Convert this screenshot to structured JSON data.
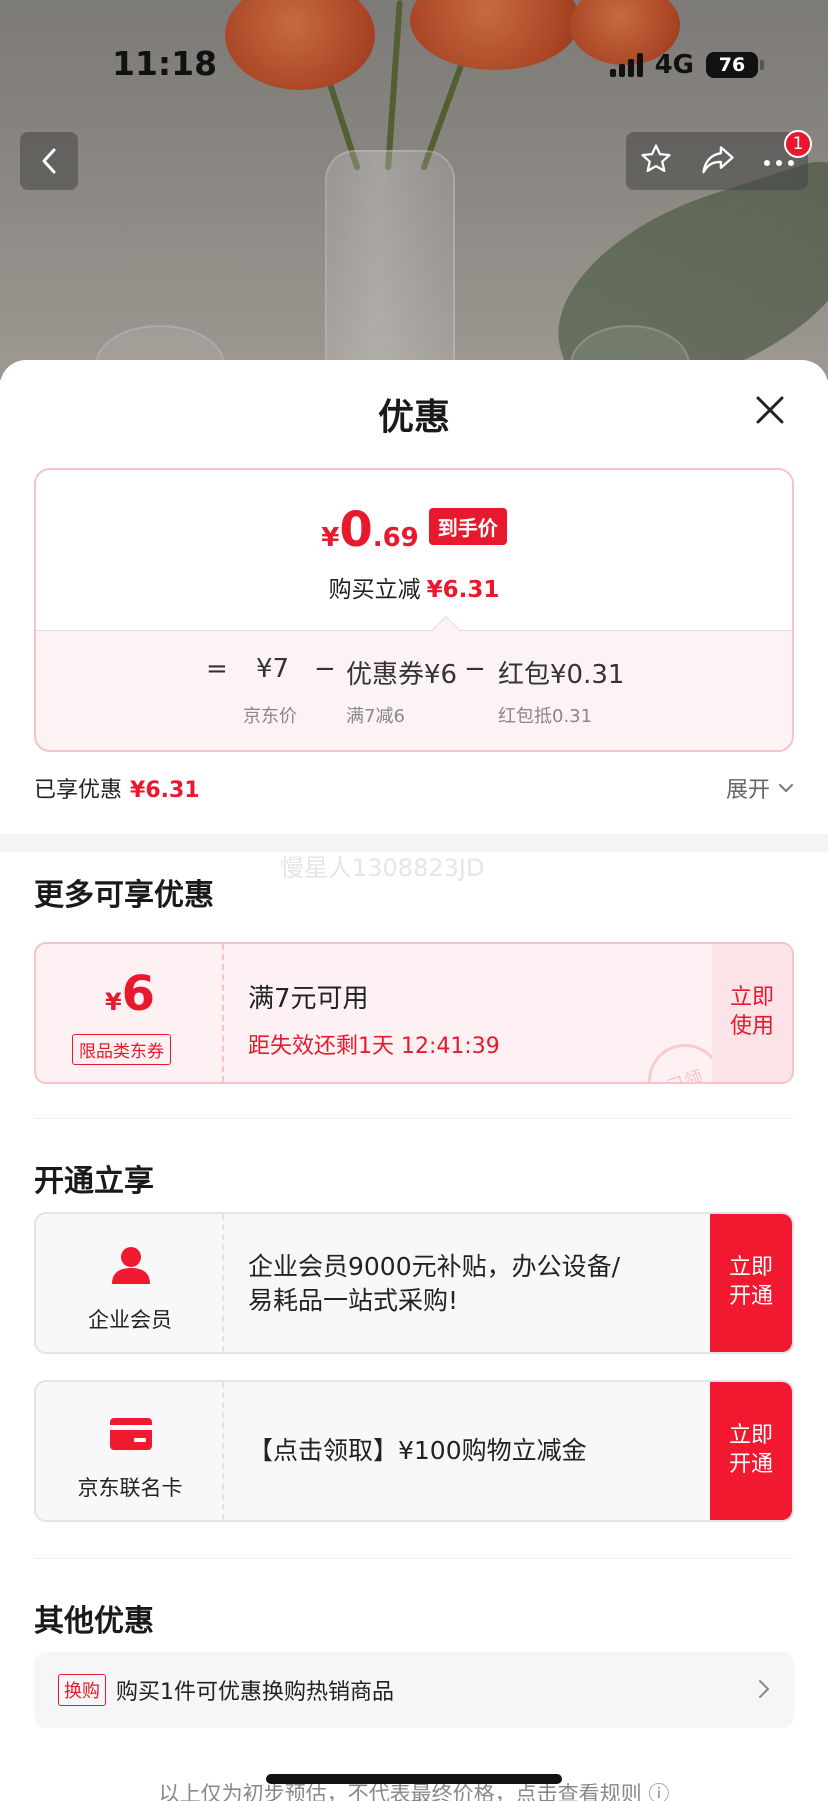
{
  "status_bar": {
    "time": "11:18",
    "network": "4G",
    "battery": "76"
  },
  "nav": {
    "badge_count": "1"
  },
  "sheet": {
    "title": "优惠",
    "price": {
      "currency": "¥",
      "integer": "0",
      "decimal": ".69",
      "tag": "到手价",
      "reduce_label": "购买立减",
      "reduce_value": "¥6.31"
    },
    "breakdown": {
      "equals": "=",
      "jd_price": "¥7",
      "jd_price_label": "京东价",
      "minus1": "−",
      "coupon": "优惠券¥6",
      "coupon_label": "满7减6",
      "minus2": "−",
      "redpack": "红包¥0.31",
      "redpack_label": "红包抵0.31"
    },
    "enjoyed_label": "已享优惠",
    "enjoyed_value": "¥6.31",
    "expand_label": "展开",
    "watermark": "慢星人1308823JD"
  },
  "more": {
    "title": "更多可享优惠",
    "coupon": {
      "currency": "¥",
      "amount": "6",
      "type": "限品类东券",
      "condition": "满7元可用",
      "expire": "距失效还剩1天 12:41:39",
      "button": "立即\n使用",
      "stamp": "已领"
    }
  },
  "open": {
    "title": "开通立享",
    "cards": [
      {
        "name": "企业会员",
        "icon": "user-icon",
        "desc": "企业会员9000元补贴，办公设备/易耗品一站式采购!",
        "button": "立即\n开通"
      },
      {
        "name": "京东联名卡",
        "icon": "credit-card-icon",
        "desc": "【点击领取】¥100购物立减金",
        "button": "立即\n开通"
      }
    ]
  },
  "other": {
    "title": "其他优惠",
    "row": {
      "tag": "换购",
      "text": "购买1件可优惠换购热销商品"
    }
  },
  "footnote": "以上仅为初步预估，不代表最终价格，点击查看规则 ⓘ",
  "colors": {
    "accent": "#e8192c",
    "pink_border": "#f6c3c9",
    "pink_bg": "#fdf1f3"
  }
}
